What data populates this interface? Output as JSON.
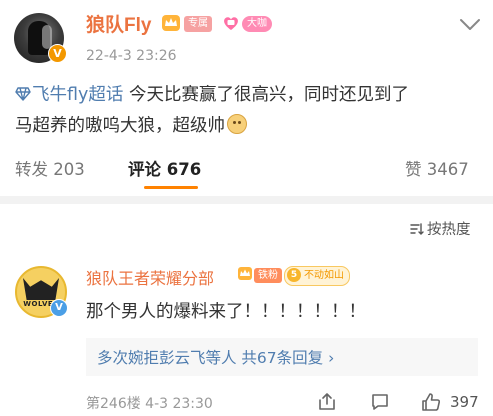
{
  "post": {
    "author": "狼队Fly",
    "tag_exclusive": "专属",
    "tag_big": "大咖",
    "time": "22-4-3 23:26",
    "topic": "飞牛fly超话",
    "text_line1": " 今天比赛赢了很高兴，同时还见到了",
    "text_line2": "马超养的嗷呜大狼，超级帅",
    "verified_badge": "V"
  },
  "actions": {
    "repost_label": "转发",
    "repost_count": "203",
    "comment_label": "评论",
    "comment_count": "676",
    "like_label": "赞",
    "like_count": "3467"
  },
  "sort": {
    "label": "按热度"
  },
  "comment": {
    "author": "狼队王者荣耀分部",
    "tag_fan": "铁粉",
    "fan_level": "5",
    "fan_title": "不动如山",
    "avatar_text": "WOLVES",
    "verified_badge": "V",
    "text": "那个男人的爆料来了！！！！！！！",
    "reply_summary": "多次婉拒彭云飞等人 共67条回复 ›",
    "floor_time": "第246楼 4-3 23:30",
    "like_count": "397"
  },
  "colors": {
    "author_orange": "#eb7340",
    "link_blue": "#507daf",
    "accent": "#ff8200"
  },
  "icons": [
    "crown-icon",
    "heart-badge-icon",
    "chevron-down-icon",
    "diamond-icon",
    "smile-emoji-icon",
    "sort-icon",
    "share-icon",
    "comment-icon",
    "like-icon"
  ]
}
